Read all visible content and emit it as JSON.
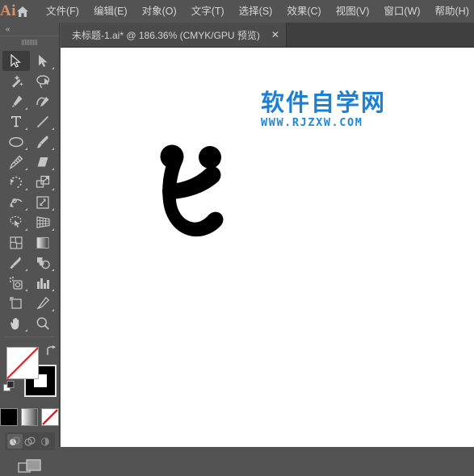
{
  "app": {
    "logo_text": "Ai",
    "accent_color": "#d9926a",
    "ui_bg": "#535353"
  },
  "menubar": {
    "home_icon": "home-icon",
    "items": [
      {
        "label": "文件(F)",
        "name": "menu-file"
      },
      {
        "label": "编辑(E)",
        "name": "menu-edit"
      },
      {
        "label": "对象(O)",
        "name": "menu-object"
      },
      {
        "label": "文字(T)",
        "name": "menu-type"
      },
      {
        "label": "选择(S)",
        "name": "menu-select"
      },
      {
        "label": "效果(C)",
        "name": "menu-effect"
      },
      {
        "label": "视图(V)",
        "name": "menu-view"
      },
      {
        "label": "窗口(W)",
        "name": "menu-window"
      },
      {
        "label": "帮助(H)",
        "name": "menu-help"
      }
    ]
  },
  "tabbar": {
    "tab_label": "未标题-1.ai* @ 186.36% (CMYK/GPU 预览)",
    "close_glyph": "✕"
  },
  "toolpanel": {
    "collapse_glyph": "«",
    "tools": [
      {
        "name": "selection-tool",
        "label": "选择工具",
        "active": true,
        "hasCorner": false
      },
      {
        "name": "direct-selection-tool",
        "label": "直接选择工具",
        "active": false,
        "hasCorner": true
      },
      {
        "name": "magic-wand-tool",
        "label": "魔棒工具",
        "active": false,
        "hasCorner": false
      },
      {
        "name": "lasso-tool",
        "label": "套索工具",
        "active": false,
        "hasCorner": false
      },
      {
        "name": "pen-tool",
        "label": "钢笔工具",
        "active": false,
        "hasCorner": true
      },
      {
        "name": "curvature-tool",
        "label": "曲率工具",
        "active": false,
        "hasCorner": false
      },
      {
        "name": "type-tool",
        "label": "文字工具",
        "active": false,
        "hasCorner": true
      },
      {
        "name": "line-segment-tool",
        "label": "直线段工具",
        "active": false,
        "hasCorner": true
      },
      {
        "name": "ellipse-tool",
        "label": "椭圆工具",
        "active": false,
        "hasCorner": true
      },
      {
        "name": "paintbrush-tool",
        "label": "画笔工具",
        "active": false,
        "hasCorner": true
      },
      {
        "name": "blob-brush-tool",
        "label": "斑点画笔工具",
        "active": false,
        "hasCorner": true
      },
      {
        "name": "eraser-tool",
        "label": "橡皮擦工具",
        "active": false,
        "hasCorner": true
      },
      {
        "name": "rotate-tool",
        "label": "旋转工具",
        "active": false,
        "hasCorner": true
      },
      {
        "name": "scale-tool",
        "label": "比例缩放工具",
        "active": false,
        "hasCorner": true
      },
      {
        "name": "width-tool",
        "label": "宽度工具",
        "active": false,
        "hasCorner": true
      },
      {
        "name": "free-transform-tool",
        "label": "自由变换工具",
        "active": false,
        "hasCorner": true
      },
      {
        "name": "shape-builder-tool",
        "label": "形状生成器工具",
        "active": false,
        "hasCorner": true
      },
      {
        "name": "perspective-grid-tool",
        "label": "透视网格工具",
        "active": false,
        "hasCorner": true
      },
      {
        "name": "mesh-tool",
        "label": "网格工具",
        "active": false,
        "hasCorner": false
      },
      {
        "name": "gradient-tool",
        "label": "渐变工具",
        "active": false,
        "hasCorner": false
      },
      {
        "name": "eyedropper-tool",
        "label": "吸管工具",
        "active": false,
        "hasCorner": true
      },
      {
        "name": "blend-tool",
        "label": "混合工具",
        "active": false,
        "hasCorner": true
      },
      {
        "name": "symbol-sprayer-tool",
        "label": "符号喷枪工具",
        "active": false,
        "hasCorner": true
      },
      {
        "name": "column-graph-tool",
        "label": "柱形图工具",
        "active": false,
        "hasCorner": true
      },
      {
        "name": "artboard-tool",
        "label": "画板工具",
        "active": false,
        "hasCorner": false
      },
      {
        "name": "slice-tool",
        "label": "切片工具",
        "active": false,
        "hasCorner": true
      },
      {
        "name": "hand-tool",
        "label": "抓手工具",
        "active": false,
        "hasCorner": true
      },
      {
        "name": "zoom-tool",
        "label": "缩放工具",
        "active": false,
        "hasCorner": false
      }
    ],
    "fill": {
      "name": "fill-swatch",
      "value": "none",
      "color": "#ffffff"
    },
    "stroke": {
      "name": "stroke-swatch",
      "value": "black",
      "color": "#000000"
    },
    "swap_icon": "swap-fill-stroke-icon",
    "default_icon": "default-fill-stroke-icon",
    "color_modes": [
      {
        "name": "color-mode-solid",
        "label": "颜色",
        "active": false
      },
      {
        "name": "color-mode-gradient",
        "label": "渐变",
        "active": false
      },
      {
        "name": "color-mode-none",
        "label": "无",
        "active": true
      }
    ],
    "draw_modes": [
      {
        "name": "draw-normal-mode",
        "label": "正常绘图",
        "active": true
      },
      {
        "name": "draw-behind-mode",
        "label": "背面绘图",
        "active": false
      },
      {
        "name": "draw-inside-mode",
        "label": "内部绘图",
        "active": false
      }
    ],
    "screen_mode": {
      "name": "change-screen-mode",
      "label": "更改屏幕模式"
    }
  },
  "canvas": {
    "artwork_name": "vector-glyph-artwork",
    "artwork_color": "#000000",
    "background": "#ffffff",
    "watermark": {
      "cn_text": "软件自学网",
      "url_text": "WWW.RJZXW.COM",
      "color": "#1b7fd3"
    }
  }
}
